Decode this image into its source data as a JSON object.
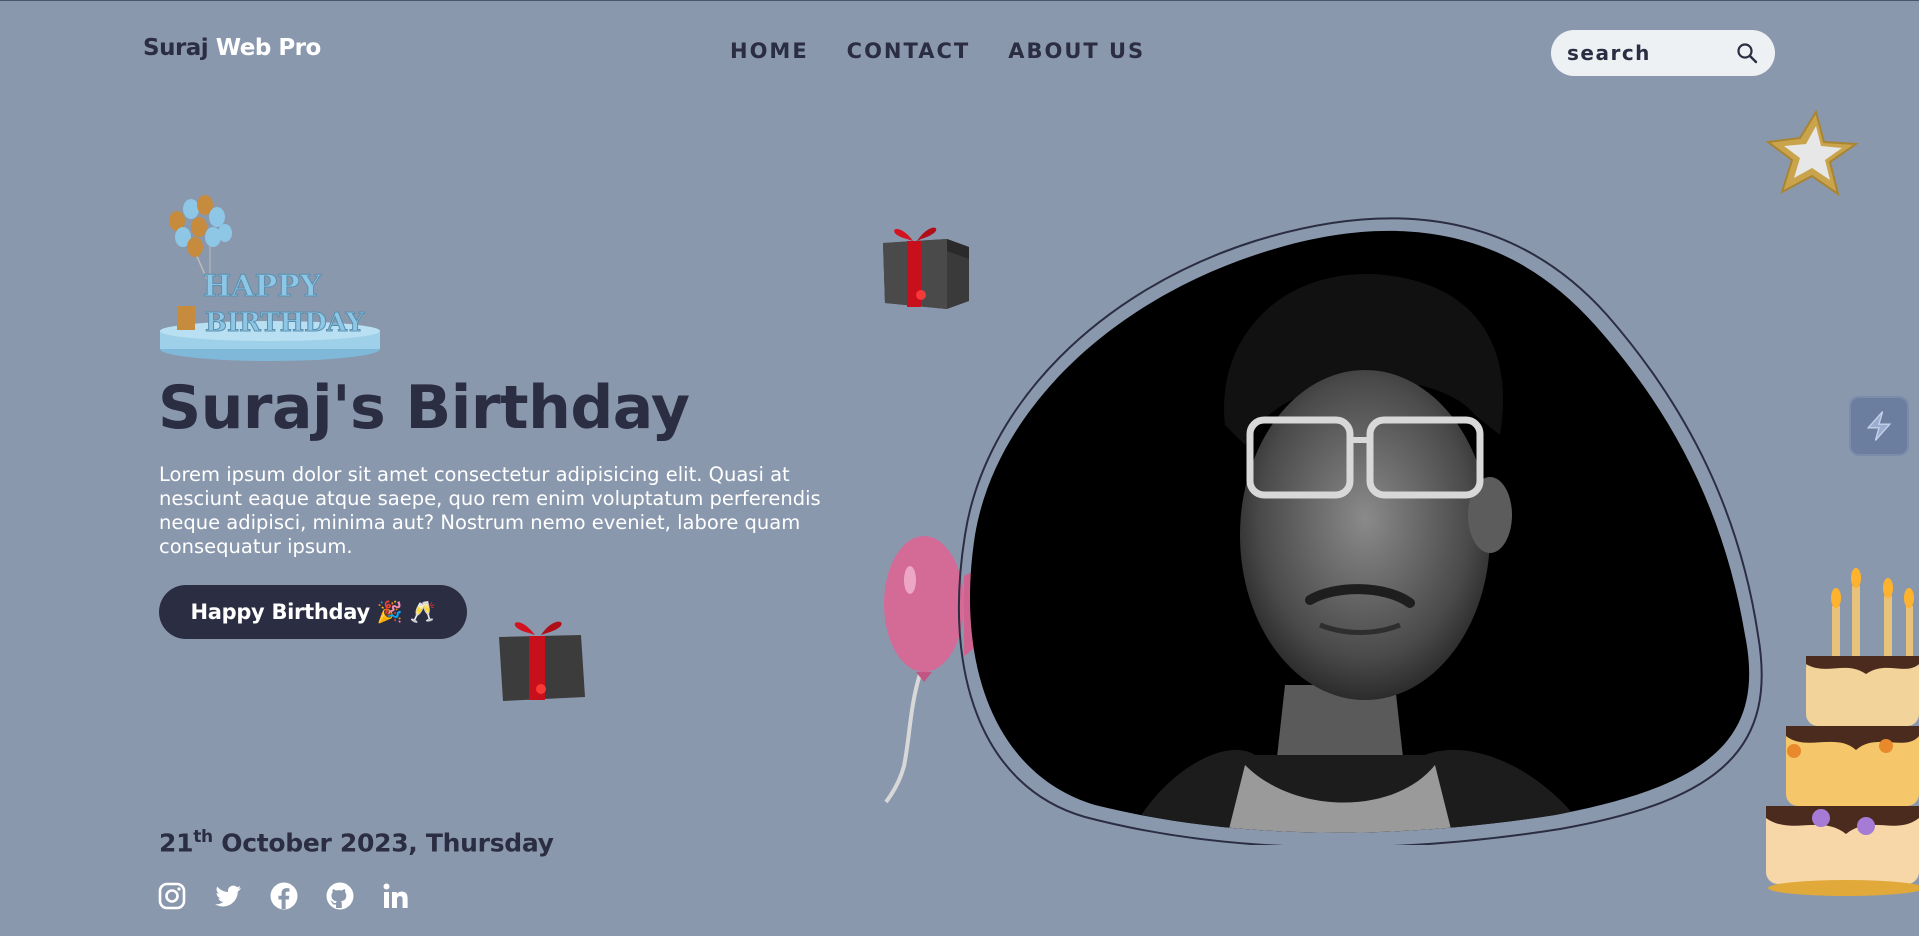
{
  "header": {
    "brand_part1": "Suraj",
    "brand_part2": "Web Pro",
    "nav": [
      "HOME",
      "CONTACT",
      "ABOUT US"
    ],
    "search_placeholder": "search"
  },
  "hero": {
    "badge_line1": "HAPPY",
    "badge_line2": "BIRTHDAY",
    "title": "Suraj's Birthday",
    "description": "Lorem ipsum dolor sit amet consectetur adipisicing elit. Quasi at nesciunt eaque atque saepe, quo rem enim voluptatum perferendis neque adipisci, minima aut? Nostrum nemo eveniet, labore quam consequatur ipsum.",
    "cta_label": "Happy Birthday 🎉 🥂",
    "date_day": "21",
    "date_suffix": "th",
    "date_rest": " October 2023, Thursday"
  },
  "socials": [
    "instagram-icon",
    "twitter-icon",
    "facebook-icon",
    "github-icon",
    "linkedin-icon"
  ],
  "colors": {
    "background": "#8a98ae",
    "dark": "#2b2d42",
    "white": "#ffffff"
  }
}
